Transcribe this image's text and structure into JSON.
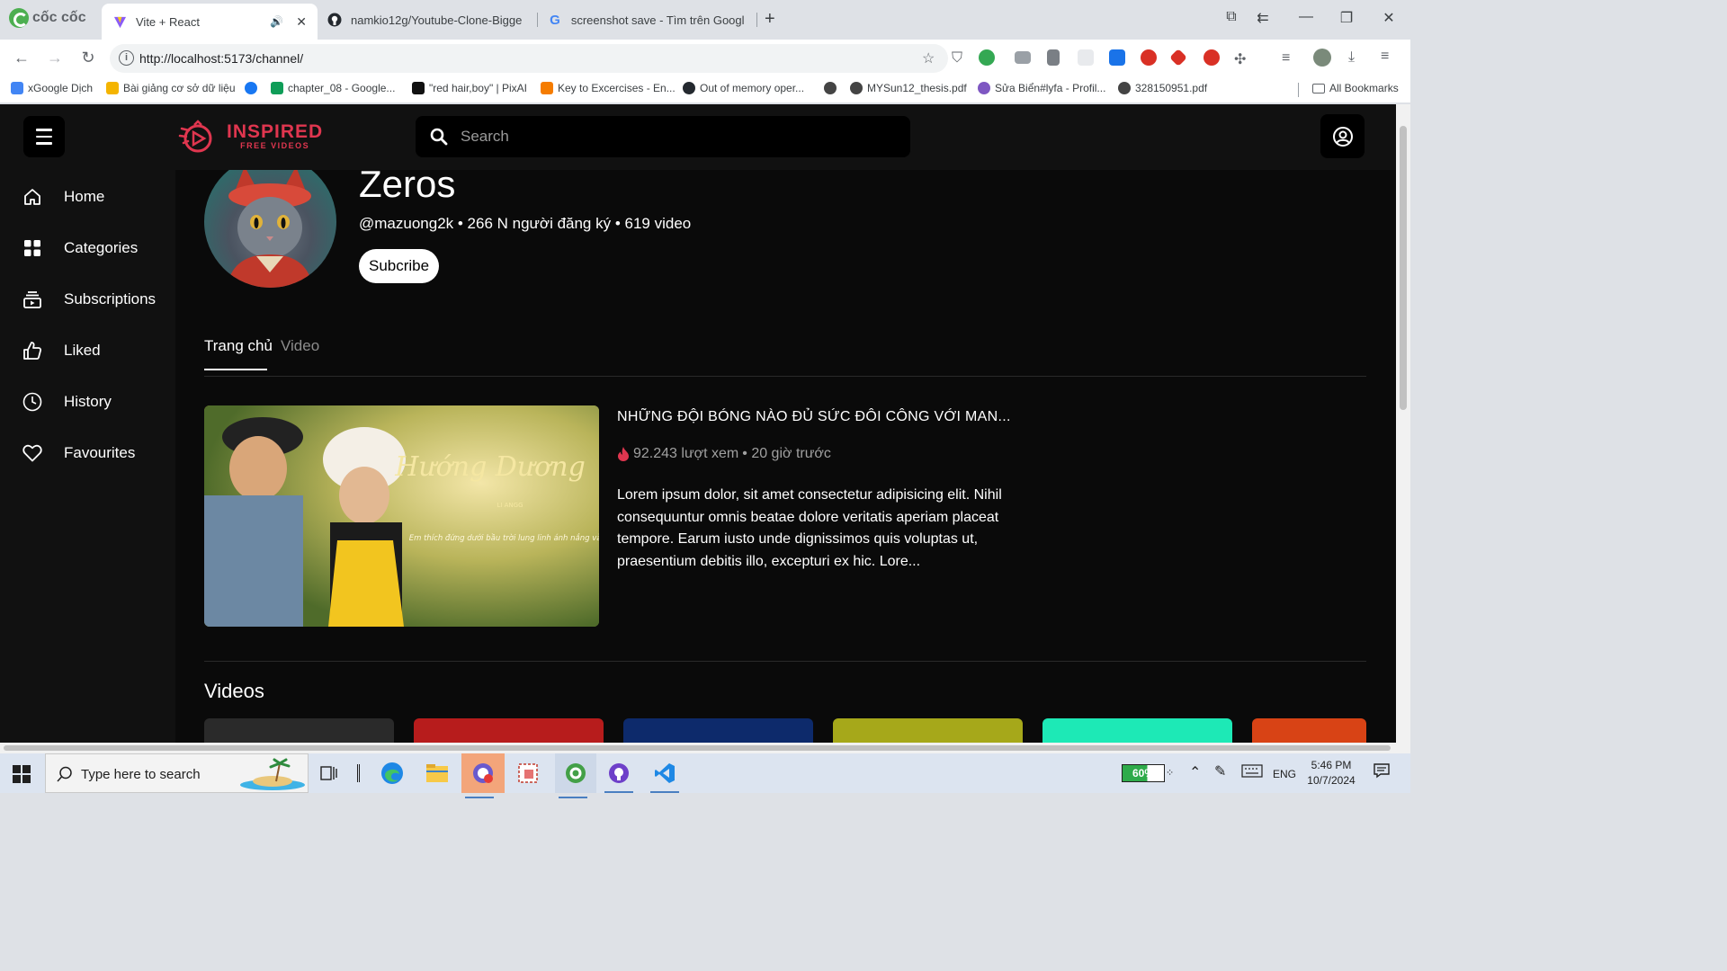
{
  "browser": {
    "logo_text": "cốc cốc",
    "tabs": [
      {
        "title": "Vite + React",
        "active": true
      },
      {
        "title": "namkio12g/Youtube-Clone-Bigge",
        "active": false
      },
      {
        "title": "screenshot save - Tìm trên Googl",
        "active": false
      }
    ],
    "url": "http://localhost:5173/channel/",
    "bookmarks": [
      {
        "label": "xGoogle Dịch",
        "color": "#4285f4"
      },
      {
        "label": "Bài giảng cơ sở dữ liệu",
        "color": "#f4b400"
      },
      {
        "label": "",
        "color": "#1877f2"
      },
      {
        "label": "chapter_08 - Google...",
        "color": "#0f9d58"
      },
      {
        "label": "\"red hair,boy\" | PixAI",
        "color": "#111111"
      },
      {
        "label": "Key to Excercises - En...",
        "color": "#f57c00"
      },
      {
        "label": "Out of memory oper...",
        "color": "#24292f"
      },
      {
        "label": "",
        "color": "#444444"
      },
      {
        "label": "MYSun12_thesis.pdf",
        "color": "#444444"
      },
      {
        "label": "Sửa Biển#lyfa - Profil...",
        "color": "#7e57c2"
      },
      {
        "label": "328150951.pdf",
        "color": "#444444"
      }
    ],
    "all_bookmarks_label": "All Bookmarks"
  },
  "app": {
    "brand_name": "INSPIRED",
    "brand_sub": "FREE VIDEOS",
    "search_placeholder": "Search",
    "accent_color": "#e0364f",
    "sidebar": [
      {
        "label": "Home",
        "icon": "home-icon"
      },
      {
        "label": "Categories",
        "icon": "grid-icon"
      },
      {
        "label": "Subscriptions",
        "icon": "subscriptions-icon"
      },
      {
        "label": "Liked",
        "icon": "thumbs-up-icon"
      },
      {
        "label": "History",
        "icon": "clock-icon"
      },
      {
        "label": "Favourites",
        "icon": "heart-icon"
      }
    ],
    "channel": {
      "name": "Zeros",
      "meta": "@mazuong2k • 266 N người đăng ký • 619 video",
      "subscribe_label": "Subcribe",
      "tabs": [
        "Trang chủ",
        "Video"
      ]
    },
    "featured": {
      "title": "NHỮNG ĐỘI BÓNG NÀO ĐỦ SỨC ĐÔI CÔNG VỚI MAN...",
      "views": "92.243 lượt xem",
      "time": "• 20 giờ trước",
      "description": "Lorem ipsum dolor, sit amet consectetur adipisicing elit. Nihil consequuntur omnis beatae dolore veritatis aperiam placeat tempore. Earum iusto unde dignissimos quis voluptas ut, praesentium debitis illo, excepturi ex hic. Lore...",
      "thumb_title": "Hướng Dương",
      "thumb_artist": "LI ANGG",
      "thumb_caption": "Em thích đứng dưới bầu trời lung linh ánh nắng vàng"
    },
    "videos_title": "Videos",
    "video_cards": [
      {
        "color": "#2a2a2a"
      },
      {
        "color": "#b71c1c"
      },
      {
        "color": "#0d2a6b"
      },
      {
        "color": "#a6a81a"
      },
      {
        "color": "#1de9b6"
      },
      {
        "color": "#d84315"
      }
    ]
  },
  "taskbar": {
    "search_placeholder": "Type here to search",
    "battery": "60%",
    "language": "ENG",
    "time": "5:46 PM",
    "date": "10/7/2024"
  }
}
